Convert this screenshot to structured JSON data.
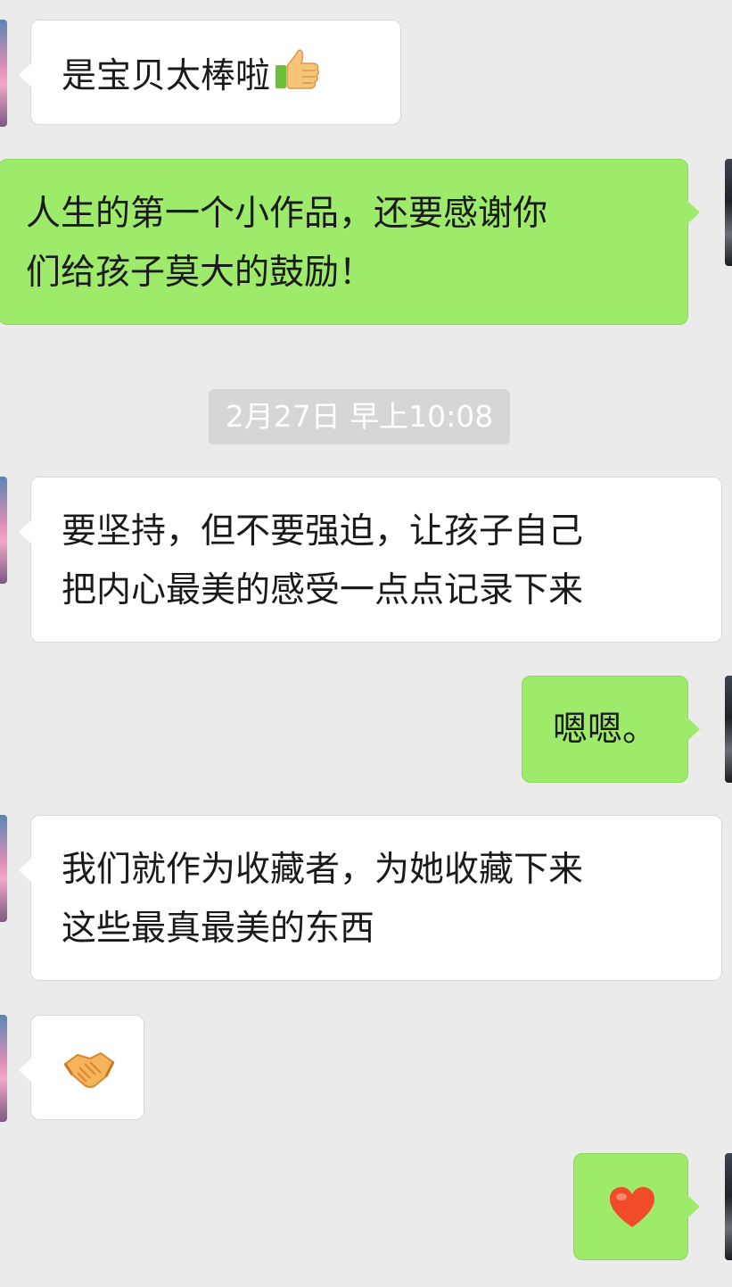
{
  "messages": [
    {
      "from": "other",
      "text": "是宝贝太棒啦"
    },
    {
      "from": "me",
      "text": "人生的第一个小作品，还要感谢你\n们给孩子莫大的鼓励！"
    },
    {
      "from": "other",
      "text": "要坚持，但不要强迫，让孩子自己\n把内心最美的感受一点点记录下来"
    },
    {
      "from": "me",
      "text": "嗯嗯。"
    },
    {
      "from": "other",
      "text": "我们就作为收藏者，为她收藏下来\n这些最真最美的东西"
    }
  ],
  "timestamp": "2月27日 早上10:08",
  "icons": {
    "thumbs_up": "thumbs-up-icon",
    "handshake": "handshake-icon",
    "heart": "heart-icon"
  },
  "colors": {
    "background": "#ebebeb",
    "sent_bubble": "#9eea6a",
    "received_bubble": "#ffffff",
    "timestamp_bg": "#d6d6d6",
    "heart": "#f04c2a"
  }
}
